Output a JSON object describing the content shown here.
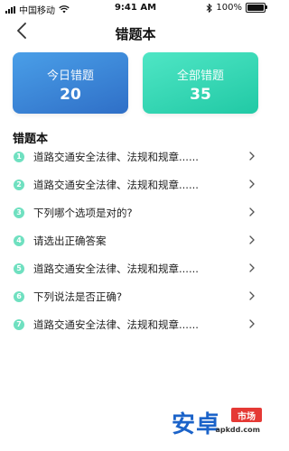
{
  "status_bar": {
    "carrier": "中国移动",
    "time": "9:41 AM",
    "battery_percent": "100%",
    "battery_level": 1.0
  },
  "header": {
    "title": "错题本",
    "back_icon": "chevron-left-icon"
  },
  "stats": {
    "today": {
      "label": "今日错题",
      "value": "20",
      "color_start": "#4a9fe8",
      "color_end": "#2f6fc7"
    },
    "all": {
      "label": "全部错题",
      "value": "35",
      "color_start": "#4fe6c5",
      "color_end": "#21c9a5"
    }
  },
  "section": {
    "title": "错题本"
  },
  "items": [
    {
      "index": "1",
      "text": "道路交通安全法律、法规和规章......"
    },
    {
      "index": "2",
      "text": "道路交通安全法律、法规和规章......"
    },
    {
      "index": "3",
      "text": "下列哪个选项是对的?"
    },
    {
      "index": "4",
      "text": "请选出正确答案"
    },
    {
      "index": "5",
      "text": "道路交通安全法律、法规和规章......"
    },
    {
      "index": "6",
      "text": "下列说法是否正确?"
    },
    {
      "index": "7",
      "text": "道路交通安全法律、法规和规章......"
    }
  ],
  "watermark": {
    "main": "安卓",
    "box": "市场",
    "sub": "apkdd.com"
  },
  "colors": {
    "badge": "#6fe0c0",
    "watermark_blue": "#1b63c9",
    "watermark_red": "#e53935"
  }
}
